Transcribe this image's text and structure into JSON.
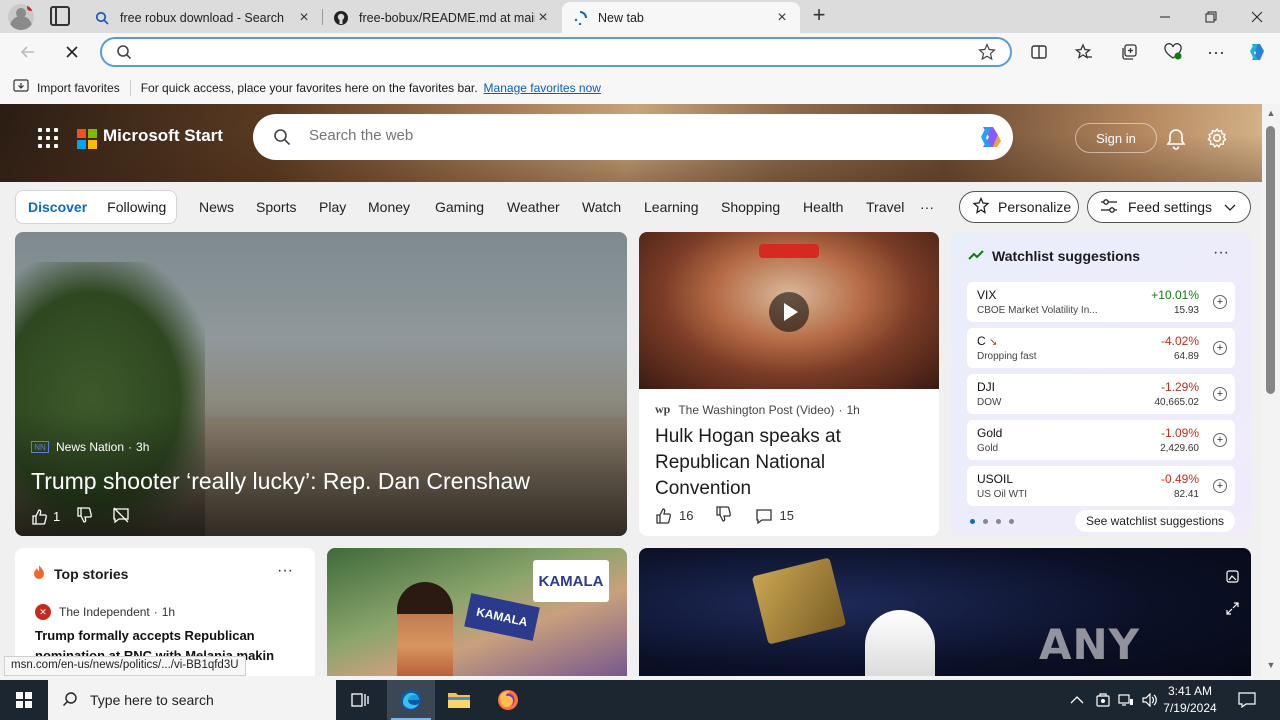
{
  "browser": {
    "tabs": [
      {
        "title": "free robux download - Search",
        "active": false
      },
      {
        "title": "free-bobux/README.md at main",
        "active": false
      },
      {
        "title": "New tab",
        "active": true
      }
    ],
    "address": {
      "value": "",
      "placeholder": ""
    },
    "favorites_bar": {
      "import_label": "Import favorites",
      "hint": "For quick access, place your favorites here on the favorites bar.",
      "manage_link": "Manage favorites now"
    },
    "status_url": "msn.com/en-us/news/politics/.../vi-BB1qfd3U"
  },
  "page": {
    "brand": "Microsoft Start",
    "search_placeholder": "Search the web",
    "sign_in": "Sign in",
    "feed_tabs": {
      "discover": "Discover",
      "following": "Following"
    },
    "categories": [
      "News",
      "Sports",
      "Play",
      "Money",
      "Gaming",
      "Weather",
      "Watch",
      "Learning",
      "Shopping",
      "Health",
      "Travel"
    ],
    "more_dots": "···",
    "personalize": "Personalize",
    "feed_settings": "Feed settings",
    "main_story": {
      "source": "News Nation",
      "time": "3h",
      "headline": "Trump shooter ‘really lucky’: Rep. Dan Crenshaw",
      "likes": "1",
      "source_logo": "NN"
    },
    "video_story": {
      "source": "The Washington Post (Video)",
      "time": "1h",
      "headline": "Hulk Hogan speaks at Republican National Convention",
      "likes": "16",
      "comments": "15",
      "source_logo": "wp"
    },
    "watchlist": {
      "title": "Watchlist suggestions",
      "items": [
        {
          "symbol": "VIX",
          "name": "CBOE Market Volatility In...",
          "change": "+10.01%",
          "value": "15.93",
          "direction": "up"
        },
        {
          "symbol": "C",
          "name": "Dropping fast",
          "change": "-4.02%",
          "value": "64.89",
          "direction": "down"
        },
        {
          "symbol": "DJI",
          "name": "DOW",
          "change": "-1.29%",
          "value": "40,665.02",
          "direction": "down"
        },
        {
          "symbol": "Gold",
          "name": "Gold",
          "change": "-1.09%",
          "value": "2,429.60",
          "direction": "down"
        },
        {
          "symbol": "USOIL",
          "name": "US Oil WTI",
          "change": "-0.49%",
          "value": "82.41",
          "direction": "down"
        }
      ],
      "see_more": "See watchlist suggestions"
    },
    "top_stories": {
      "title": "Top stories",
      "source": "The Independent",
      "time": "1h",
      "headline": "Trump formally accepts Republican nomination at RNC with Melania makin"
    },
    "kamala_card": {
      "sign_text": "KAMALA",
      "sign2_text": "KAMALA"
    },
    "watermark": "ANY RUN"
  },
  "taskbar": {
    "search_placeholder": "Type here to search",
    "time": "3:41 AM",
    "date": "7/19/2024"
  },
  "colors": {
    "accent": "#0f6cbd",
    "positive": "#107c10",
    "negative": "#c42b1c",
    "taskbar": "#1c2630"
  }
}
